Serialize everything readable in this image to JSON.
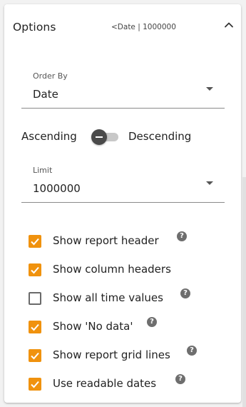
{
  "panel": {
    "title": "Options",
    "summary": "<Date | 1000000"
  },
  "order_by": {
    "label": "Order By",
    "value": "Date"
  },
  "sort": {
    "ascending_label": "Ascending",
    "descending_label": "Descending",
    "toggle_state": "off"
  },
  "limit": {
    "label": "Limit",
    "value": "1000000"
  },
  "options": [
    {
      "label": "Show report header",
      "checked": true,
      "help": true
    },
    {
      "label": "Show column headers",
      "checked": true,
      "help": false
    },
    {
      "label": "Show all time values",
      "checked": false,
      "help": true
    },
    {
      "label": "Show 'No data'",
      "checked": true,
      "help": true
    },
    {
      "label": "Show report grid lines",
      "checked": true,
      "help": true
    },
    {
      "label": "Use readable dates",
      "checked": true,
      "help": true
    }
  ],
  "help_glyph": "?",
  "colors": {
    "accent": "#f0920e",
    "text": "#222222",
    "help_icon": "#6e6e6e"
  },
  "icons": {
    "collapse": "chevron-up-icon",
    "dropdown": "caret-down-icon",
    "help": "question-circle-icon",
    "check": "checkmark-icon"
  }
}
